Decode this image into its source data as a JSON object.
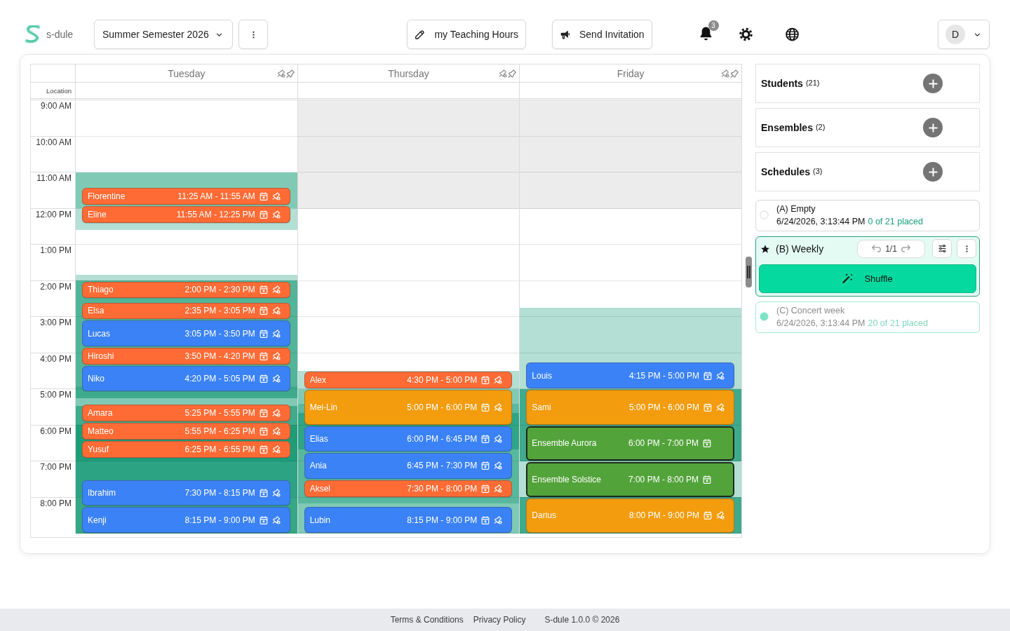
{
  "app": {
    "name": "s-dule"
  },
  "header": {
    "semester": {
      "value": "Summer Semester 2026"
    },
    "buttons": [
      {
        "label": "my Teaching Hours",
        "kind": "hours"
      },
      {
        "label": "Send Invitation",
        "kind": "invite"
      }
    ],
    "notifications": {
      "count": "3"
    },
    "user": {
      "initial": "D"
    }
  },
  "calendar": {
    "location_label": "Location",
    "times": [
      "9:00 AM",
      "10:00 AM",
      "11:00 AM",
      "12:00 PM",
      "1:00 PM",
      "2:00 PM",
      "3:00 PM",
      "4:00 PM",
      "5:00 PM",
      "6:00 PM",
      "7:00 PM",
      "8:00 PM"
    ],
    "days": [
      {
        "name": "Tuesday",
        "events": [
          {
            "name": "Florentine",
            "time": "11:25 AM - 11:55 AM",
            "color": "#ff6b35",
            "kind": "student"
          },
          {
            "name": "Eline",
            "time": "11:55 AM - 12:25 PM",
            "color": "#ff6b35",
            "kind": "student"
          },
          {
            "name": "Thiago",
            "time": "2:00 PM - 2:30 PM",
            "color": "#ff6b35",
            "kind": "student"
          },
          {
            "name": "Elsa",
            "time": "2:35 PM - 3:05 PM",
            "color": "#ff6b35",
            "kind": "student"
          },
          {
            "name": "Lucas",
            "time": "3:05 PM - 3:50 PM",
            "color": "#3b82f6",
            "kind": "student"
          },
          {
            "name": "Hiroshi",
            "time": "3:50 PM - 4:20 PM",
            "color": "#ff6b35",
            "kind": "student"
          },
          {
            "name": "Niko",
            "time": "4:20 PM - 5:05 PM",
            "color": "#3b82f6",
            "kind": "student"
          },
          {
            "name": "Amara",
            "time": "5:25 PM - 5:55 PM",
            "color": "#ff6b35",
            "kind": "student"
          },
          {
            "name": "Matteo",
            "time": "5:55 PM - 6:25 PM",
            "color": "#ff6b35",
            "kind": "student"
          },
          {
            "name": "Yusuf",
            "time": "6:25 PM - 6:55 PM",
            "color": "#ff6b35",
            "kind": "student"
          },
          {
            "name": "Ibrahim",
            "time": "7:30 PM - 8:15 PM",
            "color": "#3b82f6",
            "kind": "student"
          },
          {
            "name": "Kenji",
            "time": "8:15 PM - 9:00 PM",
            "color": "#3b82f6",
            "kind": "student"
          }
        ]
      },
      {
        "name": "Thursday",
        "events": [
          {
            "name": "Alex",
            "time": "4:30 PM - 5:00 PM",
            "color": "#ff6b35",
            "kind": "student"
          },
          {
            "name": "Mei-Lin",
            "time": "5:00 PM - 6:00 PM",
            "color": "#f39c0e",
            "kind": "student"
          },
          {
            "name": "Elias",
            "time": "6:00 PM - 6:45 PM",
            "color": "#3b82f6",
            "kind": "student"
          },
          {
            "name": "Ania",
            "time": "6:45 PM - 7:30 PM",
            "color": "#3b82f6",
            "kind": "student"
          },
          {
            "name": "Aksel",
            "time": "7:30 PM - 8:00 PM",
            "color": "#ff6b35",
            "kind": "student"
          },
          {
            "name": "Lubin",
            "time": "8:15 PM - 9:00 PM",
            "color": "#3b82f6",
            "kind": "student"
          }
        ]
      },
      {
        "name": "Friday",
        "events": [
          {
            "name": "Louis",
            "time": "4:15 PM - 5:00 PM",
            "color": "#3b82f6",
            "kind": "student"
          },
          {
            "name": "Sami",
            "time": "5:00 PM - 6:00 PM",
            "color": "#f39c0e",
            "kind": "student"
          },
          {
            "name": "Ensemble Aurora",
            "time": "6:00 PM - 7:00 PM",
            "color": "#53a33b",
            "kind": "ensemble"
          },
          {
            "name": "Ensemble Solstice",
            "time": "7:00 PM - 8:00 PM",
            "color": "#53a33b",
            "kind": "ensemble"
          },
          {
            "name": "Darius",
            "time": "8:00 PM - 9:00 PM",
            "color": "#f39c0e",
            "kind": "student"
          }
        ]
      }
    ]
  },
  "sidebar": {
    "sections": [
      {
        "title": "Students",
        "count": "(21)"
      },
      {
        "title": "Ensembles",
        "count": "(2)"
      },
      {
        "title": "Schedules",
        "count": "(3)"
      }
    ],
    "schedules": [
      {
        "name": "(A) Empty",
        "timestamp": "6/24/2026, 3:13:44 PM",
        "placed": "0 of 21 placed",
        "selected": false,
        "muted": false
      },
      {
        "name": "(B) Weekly",
        "history": "1/1",
        "action": "Shuffle",
        "selected": true,
        "muted": false
      },
      {
        "name": "(C) Concert week",
        "timestamp": "6/24/2026, 3:13:44 PM",
        "placed": "20 of 21 placed",
        "selected": false,
        "muted": true
      }
    ]
  },
  "footer": {
    "links": [
      "Terms & Conditions",
      "Privacy Policy"
    ],
    "version": "S-dule 1.0.0 © 2026"
  }
}
